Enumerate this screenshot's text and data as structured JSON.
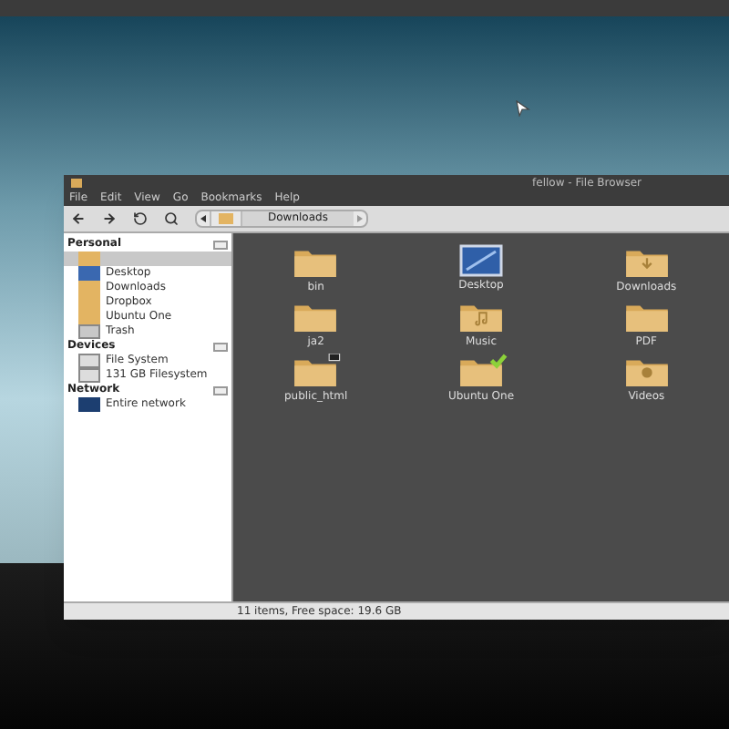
{
  "window": {
    "title": "fellow - File Browser"
  },
  "menu": [
    "File",
    "Edit",
    "View",
    "Go",
    "Bookmarks",
    "Help"
  ],
  "path": {
    "segments": [
      {
        "label": "Downloads",
        "selected": true
      }
    ]
  },
  "sidebar": {
    "sections": [
      {
        "title": "Personal",
        "items": [
          {
            "kind": "home",
            "selected": true
          },
          {
            "kind": "desktop",
            "label": "Desktop",
            "selected": false
          },
          {
            "kind": "folder",
            "label": "Downloads",
            "selected": false
          },
          {
            "kind": "folder",
            "label": "Dropbox",
            "selected": false
          },
          {
            "kind": "folder",
            "label": "Ubuntu One",
            "selected": false
          },
          {
            "kind": "trash",
            "label": "Trash",
            "selected": false
          }
        ]
      },
      {
        "title": "Devices",
        "items": [
          {
            "kind": "drive",
            "label": "File System",
            "selected": false
          },
          {
            "kind": "drive",
            "label": "131 GB Filesystem",
            "selected": false
          }
        ]
      },
      {
        "title": "Network",
        "items": [
          {
            "kind": "network",
            "label": "Entire network",
            "selected": false
          }
        ]
      }
    ]
  },
  "files": [
    {
      "kind": "folder",
      "name": "bin",
      "symlink": false,
      "synced": false
    },
    {
      "kind": "desktop",
      "name": "Desktop",
      "symlink": false,
      "synced": false
    },
    {
      "kind": "downloads",
      "name": "Downloads",
      "symlink": false,
      "synced": false
    },
    {
      "kind": "folder",
      "name": "ja2",
      "symlink": false,
      "synced": false
    },
    {
      "kind": "music",
      "name": "Music",
      "symlink": false,
      "synced": false
    },
    {
      "kind": "folder",
      "name": "PDF",
      "symlink": false,
      "synced": false
    },
    {
      "kind": "folder",
      "name": "public_html",
      "symlink": true,
      "synced": false
    },
    {
      "kind": "folder",
      "name": "Ubuntu One",
      "symlink": false,
      "synced": true
    },
    {
      "kind": "videos",
      "name": "Videos",
      "symlink": false,
      "synced": false
    }
  ],
  "status_bar": "11 items, Free space: 19.6 GB"
}
